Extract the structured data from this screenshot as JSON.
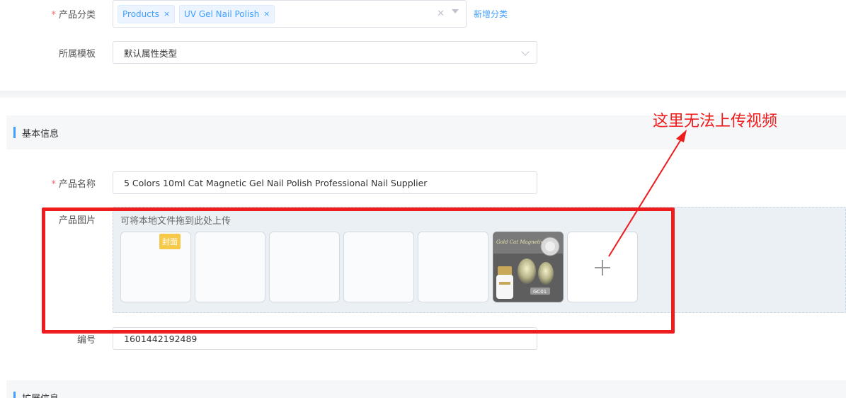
{
  "category": {
    "label": "产品分类",
    "required": "*",
    "tags": [
      {
        "text": "Products"
      },
      {
        "text": "UV Gel Nail Polish"
      }
    ],
    "remove_glyph": "×",
    "clear_glyph": "✕",
    "add_link": "新增分类"
  },
  "template": {
    "label": "所属模板",
    "value": "默认属性类型"
  },
  "basic_section": {
    "title": "基本信息"
  },
  "product_name": {
    "label": "产品名称",
    "required": "*",
    "value": "5 Colors 10ml Cat Magnetic Gel Nail Polish Professional Nail Supplier"
  },
  "product_images": {
    "label": "产品图片",
    "hint": "可将本地文件拖到此处上传",
    "cover_badge": "封面",
    "thumbnail_label": "GC01",
    "thumbnail_title": "Gold Cat Magnetic Gel"
  },
  "serial": {
    "label": "编号",
    "value": "1601442192489"
  },
  "extended_section": {
    "title": "扩展信息"
  },
  "annotation": {
    "text": "这里无法上传视频"
  },
  "colors": {
    "accent": "#409eff",
    "annotation_red": "#ee1c1c",
    "required_red": "#f56c6c",
    "badge": "#f7c948"
  }
}
